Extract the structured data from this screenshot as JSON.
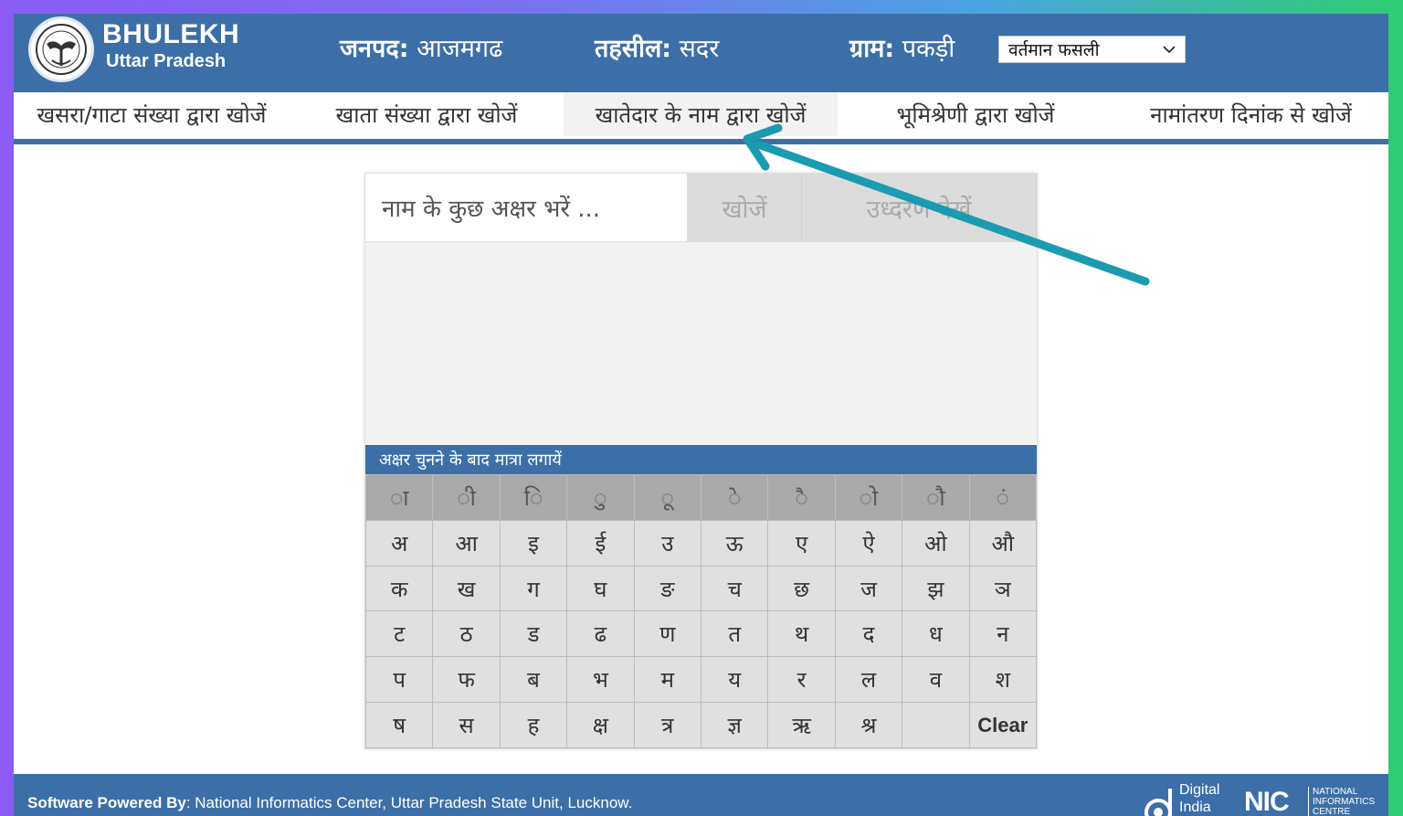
{
  "header": {
    "brand_title": "BHULEKH",
    "brand_subtitle": "Uttar Pradesh",
    "janpad_label": "जनपद:",
    "janpad_value": "आजमगढ",
    "tehsil_label": "तहसील:",
    "tehsil_value": "सदर",
    "gram_label": "ग्राम:",
    "gram_value": "पकड़ी",
    "season_select": "वर्तमान फसली"
  },
  "tabs": [
    {
      "label": "खसरा/गाटा संख्या द्वारा खोजें"
    },
    {
      "label": "खाता संख्या द्वारा खोजें"
    },
    {
      "label": "खातेदार के नाम द्वारा खोजें",
      "active": true
    },
    {
      "label": "भूमिश्रेणी द्वारा खोजें"
    },
    {
      "label": "नामांतरण दिनांक से खोजें"
    }
  ],
  "search": {
    "placeholder": "नाम के कुछ अक्षर भरें ...",
    "search_button": "खोजें",
    "extract_button": "उध्दरण देखें"
  },
  "keyboard": {
    "instruction": "अक्षर चुनने के बाद मात्रा लगायें",
    "rows": [
      [
        "ा",
        "ी",
        "ि",
        "ु",
        "ू",
        "े",
        "ै",
        "ो",
        "ौ",
        "ं"
      ],
      [
        "अ",
        "आ",
        "इ",
        "ई",
        "उ",
        "ऊ",
        "ए",
        "ऐ",
        "ओ",
        "औ"
      ],
      [
        "क",
        "ख",
        "ग",
        "घ",
        "ङ",
        "च",
        "छ",
        "ज",
        "झ",
        "ञ"
      ],
      [
        "ट",
        "ठ",
        "ड",
        "ढ",
        "ण",
        "त",
        "थ",
        "द",
        "ध",
        "न"
      ],
      [
        "प",
        "फ",
        "ब",
        "भ",
        "म",
        "य",
        "र",
        "ल",
        "व",
        "श"
      ],
      [
        "ष",
        "स",
        "ह",
        "क्ष",
        "त्र",
        "ज्ञ",
        "ऋ",
        "श्र",
        "",
        "Clear"
      ]
    ]
  },
  "footer": {
    "powered_label": "Software Powered By",
    "powered_text": ": National Informatics Center, Uttar Pradesh State Unit, Lucknow.",
    "digital_india_line1": "Digital",
    "digital_india_line2": "India",
    "nic_logo_text": "NIC",
    "nic_line1": "NATIONAL",
    "nic_line2": "INFORMATICS",
    "nic_line3": "CENTRE"
  },
  "colors": {
    "primary": "#3c6fa8",
    "annotation_arrow": "#1a9bb0"
  }
}
